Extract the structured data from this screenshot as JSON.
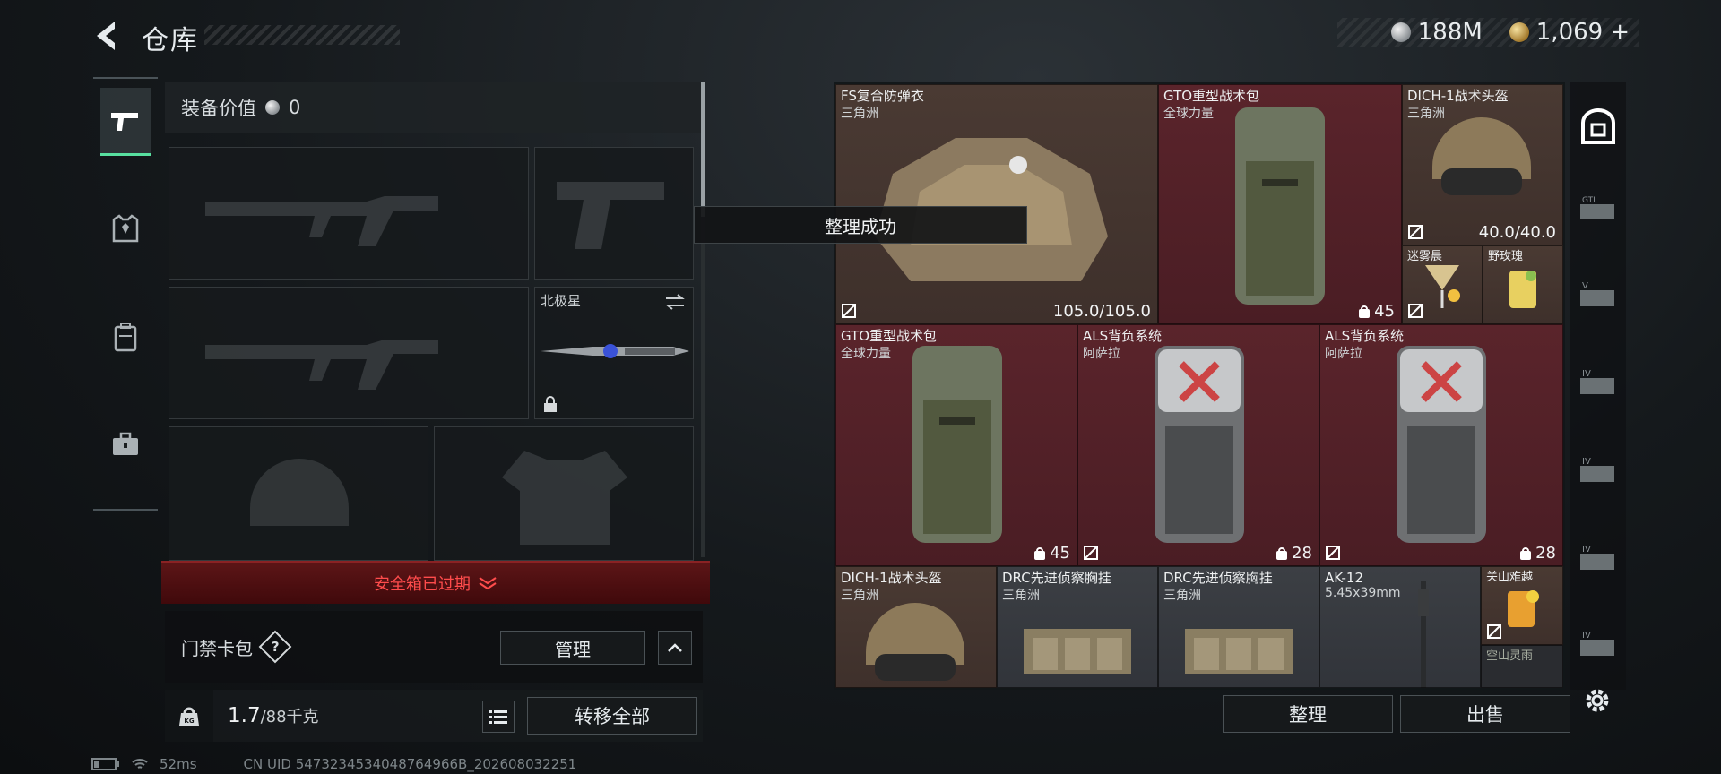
{
  "header": {
    "title": "仓库",
    "currency": [
      {
        "icon": "silver-coin-icon",
        "value": "188M"
      },
      {
        "icon": "gold-coin-icon",
        "value": "1,069",
        "suffix": "+"
      }
    ]
  },
  "left_nav": [
    {
      "icon": "pistol-icon",
      "active": true
    },
    {
      "icon": "vest-icon",
      "active": false
    },
    {
      "icon": "backpack-icon",
      "active": false
    },
    {
      "icon": "briefcase-icon",
      "active": false
    }
  ],
  "equip": {
    "value_label": "装备价值",
    "value": "0",
    "melee_name": "北极星",
    "safebox_text": "安全箱已过期",
    "keycard_label": "门禁卡包",
    "keycard_help": "?",
    "manage_label": "管理",
    "weight_current": "1.7",
    "weight_max": "/88千克",
    "weight_icon_text": "KG",
    "transfer_all_label": "转移全部"
  },
  "toast": "整理成功",
  "stash": {
    "items": [
      {
        "name": "FS复合防弹衣",
        "sub": "三角洲",
        "value": "105.0/105.0"
      },
      {
        "name": "GTO重型战术包",
        "sub": "全球力量",
        "count": "45"
      },
      {
        "name": "DICH-1战术头盔",
        "sub": "三角洲",
        "value": "40.0/40.0"
      },
      {
        "name": "迷雾晨",
        "sub": ""
      },
      {
        "name": "野玫瑰",
        "sub": ""
      },
      {
        "name": "GTO重型战术包",
        "sub": "全球力量",
        "count": "45"
      },
      {
        "name": "ALS背负系统",
        "sub": "阿萨拉",
        "count": "28"
      },
      {
        "name": "ALS背负系统",
        "sub": "阿萨拉",
        "count": "28"
      },
      {
        "name": "DICH-1战术头盔",
        "sub": "三角洲"
      },
      {
        "name": "DRC先进侦察胸挂",
        "sub": "三角洲"
      },
      {
        "name": "DRC先进侦察胸挂",
        "sub": "三角洲"
      },
      {
        "name": "AK-12",
        "sub": "5.45x39mm"
      },
      {
        "name": "关山难越",
        "sub": ""
      },
      {
        "name": "空山灵雨",
        "sub": ""
      }
    ],
    "sort_label": "整理",
    "sell_label": "出售"
  },
  "right_nav": [
    "safe-icon",
    "gti-case-icon",
    "v-case-icon",
    "iv-case-icon",
    "iv-case-warning-icon",
    "iv-case-lock-icon",
    "iv-case-plus-icon"
  ],
  "status": {
    "ping": "52ms",
    "uid": "CN UID 5473234534048764966B_202608032251"
  },
  "colors": {
    "active_accent": "#58e0a0",
    "alert_red": "#ff4c4c"
  }
}
